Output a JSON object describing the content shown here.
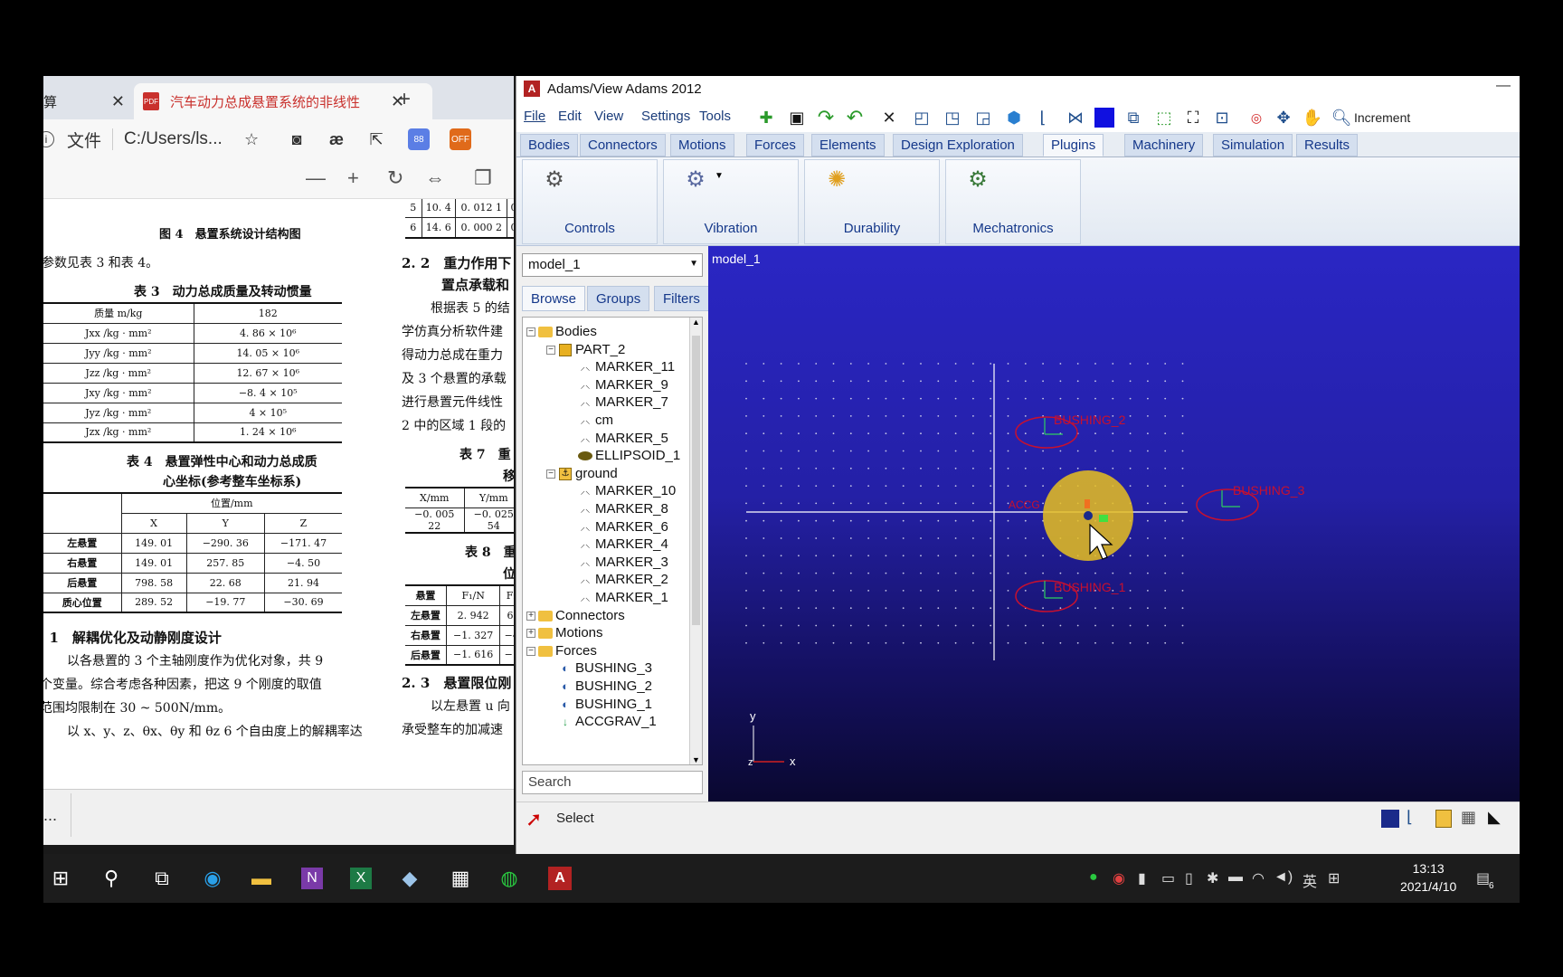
{
  "browser": {
    "tabs": [
      {
        "label": "算",
        "close": "✕"
      },
      {
        "label": "汽车动力总成悬置系统的非线性",
        "close": "✕",
        "icon": "PDF"
      }
    ],
    "new_tab": "+",
    "address": {
      "file_label": "文件",
      "path": "C:/Users/ls..."
    },
    "extensions": {
      "badge_88": "88",
      "badge_off": "OFF"
    },
    "pdf_toolbar": {
      "minus": "—",
      "plus": "+"
    },
    "doc": {
      "fig4_caption": "图 4　悬置系统设计结构图",
      "params_text": "参数见表 3 和表 4。",
      "table3_title": "表 3　动力总成质量及转动惯量",
      "table3": [
        [
          "质量 m/kg",
          "182"
        ],
        [
          "Jxx /kg · mm²",
          "4. 86 × 10⁶"
        ],
        [
          "Jyy /kg · mm²",
          "14. 05 × 10⁶"
        ],
        [
          "Jzz /kg · mm²",
          "12. 67 × 10⁶"
        ],
        [
          "Jxy /kg · mm²",
          "−8. 4 × 10⁵"
        ],
        [
          "Jyz /kg · mm²",
          "4 × 10⁵"
        ],
        [
          "Jzx /kg · mm²",
          "1. 24 × 10⁶"
        ]
      ],
      "table4_title_1": "表 4　悬置弹性中心和动力总成质",
      "table4_title_2": "心坐标(参考整车坐标系)",
      "table4_header": {
        "group": "位置/mm",
        "cols": [
          "X",
          "Y",
          "Z"
        ]
      },
      "table4": [
        [
          "左悬置",
          "149. 01",
          "−290. 36",
          "−171. 47"
        ],
        [
          "右悬置",
          "149. 01",
          "257. 85",
          "−4. 50"
        ],
        [
          "后悬置",
          "798. 58",
          "22. 68",
          "21. 94"
        ],
        [
          "质心位置",
          "289. 52",
          "−19. 77",
          "−30. 69"
        ]
      ],
      "sec31_title": ". 1　解耦优化及动静刚度设计",
      "sec31_p1": "以各悬置的 3 个主轴刚度作为优化对象，共 9",
      "sec31_p2": "个变量。综合考虑各种因素，把这 9 个刚度的取值",
      "sec31_p3": "范围均限制在 30 ~ 500N/mm。",
      "sec31_p4": "以 x、y、z、θx、θy 和 θz 6 个自由度上的解耦率达",
      "top_table": [
        [
          "5",
          "10. 4",
          "0. 012 1",
          "0."
        ],
        [
          "6",
          "14. 6",
          "0. 000 2",
          "0."
        ]
      ],
      "sec22_a": "2. 2　重力作用下",
      "sec22_b": "置点承载和",
      "sec22_c": "根据表 5 的结",
      "sec22_d": "学仿真分析软件建",
      "sec22_e": "得动力总成在重力",
      "sec22_f": "及 3 个悬置的承载",
      "sec22_g": "进行悬置元件线性",
      "sec22_h": "2 中的区域 1 段的",
      "table7_a": "表 7　重",
      "table7_b": "移",
      "table7_head": [
        "X/mm",
        "Y/mm"
      ],
      "table7_row": [
        "−0. 005 22",
        "−0. 025 54"
      ],
      "table8_a": "表 8　重",
      "table8_b": "位",
      "table8_head": [
        "悬置",
        "F₁/N",
        "F₂"
      ],
      "table8": [
        [
          "左悬置",
          "2. 942",
          "6."
        ],
        [
          "右悬置",
          "−1. 327",
          "−4"
        ],
        [
          "后悬置",
          "−1. 616",
          "−1"
        ]
      ],
      "sec23_a": "2. 3　悬置限位刚",
      "sec23_b": "以左悬置 u 向",
      "sec23_c": "承受整车的加减速"
    },
    "bottom_dots": "..."
  },
  "adams": {
    "title": "Adams/View Adams 2012",
    "logo": "A",
    "menu": [
      "File",
      "Edit",
      "View",
      "Settings",
      "Tools"
    ],
    "increment_label": "Increment",
    "ribbon_tabs": [
      "Bodies",
      "Connectors",
      "Motions",
      "Forces",
      "Elements",
      "Design Exploration",
      "Plugins",
      "Machinery",
      "Simulation",
      "Results"
    ],
    "active_tab": "Plugins",
    "ribbon_groups": [
      "Controls",
      "Vibration",
      "Durability",
      "Mechatronics"
    ],
    "model_select": "model_1",
    "browser_tabs": [
      "Browse",
      "Groups",
      "Filters"
    ],
    "tree": [
      {
        "label": "Bodies",
        "level": 0,
        "type": "folder"
      },
      {
        "label": "PART_2",
        "level": 1,
        "type": "part"
      },
      {
        "label": "MARKER_11",
        "level": 2,
        "type": "marker"
      },
      {
        "label": "MARKER_9",
        "level": 2,
        "type": "marker"
      },
      {
        "label": "MARKER_7",
        "level": 2,
        "type": "marker"
      },
      {
        "label": "cm",
        "level": 2,
        "type": "marker"
      },
      {
        "label": "MARKER_5",
        "level": 2,
        "type": "marker"
      },
      {
        "label": "ELLIPSOID_1",
        "level": 2,
        "type": "ellipsoid"
      },
      {
        "label": "ground",
        "level": 1,
        "type": "ground"
      },
      {
        "label": "MARKER_10",
        "level": 2,
        "type": "marker"
      },
      {
        "label": "MARKER_8",
        "level": 2,
        "type": "marker"
      },
      {
        "label": "MARKER_6",
        "level": 2,
        "type": "marker"
      },
      {
        "label": "MARKER_4",
        "level": 2,
        "type": "marker"
      },
      {
        "label": "MARKER_3",
        "level": 2,
        "type": "marker"
      },
      {
        "label": "MARKER_2",
        "level": 2,
        "type": "marker"
      },
      {
        "label": "MARKER_1",
        "level": 2,
        "type": "marker"
      },
      {
        "label": "Connectors",
        "level": 0,
        "type": "folder"
      },
      {
        "label": "Motions",
        "level": 0,
        "type": "folder"
      },
      {
        "label": "Forces",
        "level": 0,
        "type": "folder"
      },
      {
        "label": "BUSHING_3",
        "level": 1,
        "type": "bushing"
      },
      {
        "label": "BUSHING_2",
        "level": 1,
        "type": "bushing"
      },
      {
        "label": "BUSHING_1",
        "level": 1,
        "type": "bushing"
      },
      {
        "label": "ACCGRAV_1",
        "level": 1,
        "type": "gravity"
      }
    ],
    "search_placeholder": "Search",
    "viewport": {
      "title": "model_1",
      "labels": {
        "bushing_2": "BUSHING_2",
        "bushing_3": "BUSHING_3",
        "bushing_1": "BUSHING_1",
        "accg": "ACCG"
      },
      "axis": {
        "x": "x",
        "y": "y",
        "z": "z"
      }
    },
    "status": "Select"
  },
  "taskbar": {
    "clock_time": "13:13",
    "clock_date": "2021/4/10",
    "ime": "英",
    "notifications": "6"
  },
  "colors": {
    "accent": "#15388a",
    "viewport_top": "#2a26c4",
    "label_red": "#c8102e"
  }
}
